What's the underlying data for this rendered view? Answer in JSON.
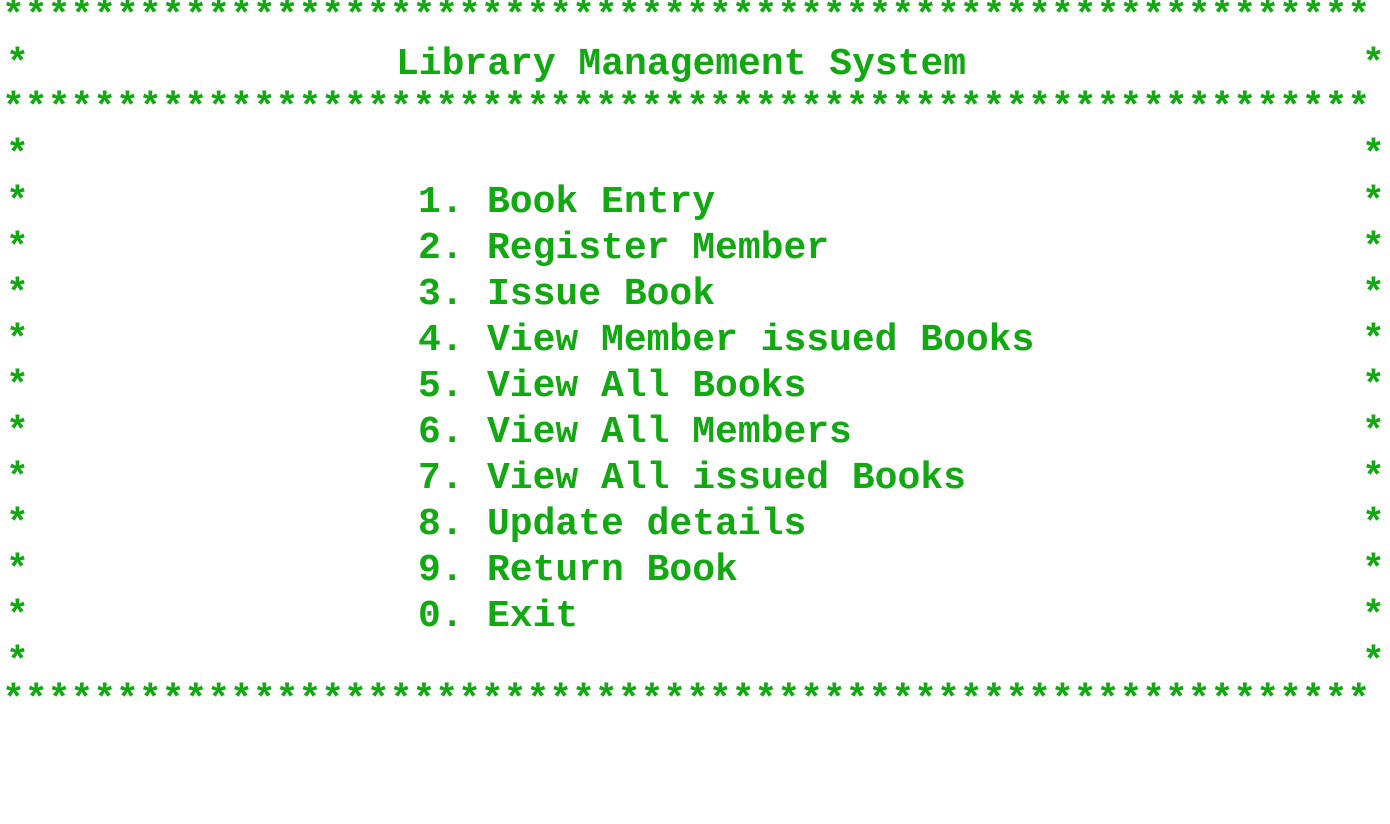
{
  "border": {
    "top": "************************************************************",
    "separator": "************************************************************",
    "bottom": "************************************************************",
    "side": "*"
  },
  "title": "Library Management System",
  "menu": [
    {
      "number": "1.",
      "label": "Book Entry"
    },
    {
      "number": "2.",
      "label": "Register Member"
    },
    {
      "number": "3.",
      "label": "Issue Book"
    },
    {
      "number": "4.",
      "label": "View Member issued Books"
    },
    {
      "number": "5.",
      "label": "View All Books"
    },
    {
      "number": "6.",
      "label": "View All Members"
    },
    {
      "number": "7.",
      "label": "View All issued Books"
    },
    {
      "number": "8.",
      "label": "Update details"
    },
    {
      "number": "9.",
      "label": "Return Book"
    },
    {
      "number": "0.",
      "label": "Exit"
    }
  ],
  "colors": {
    "text": "#12a812",
    "background": "#ffffff"
  }
}
